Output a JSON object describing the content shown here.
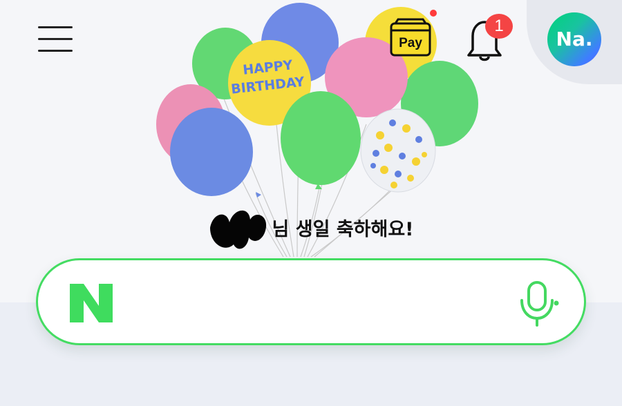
{
  "header": {
    "pay_label": "Pay",
    "notification_count": "1",
    "avatar_label": "Na."
  },
  "balloons": {
    "birthday_text_line1": "HAPPY",
    "birthday_text_line2": "BIRTHDAY"
  },
  "greeting": {
    "text": "님 생일 축하해요!"
  },
  "search": {
    "logo_letter": "N",
    "value": "",
    "placeholder": ""
  },
  "colors": {
    "accent_green": "#44dc62",
    "badge_red": "#f44444"
  },
  "icons": {
    "menu": "hamburger-icon",
    "pay": "pay-icon",
    "bell": "bell-icon",
    "mic": "microphone-icon"
  }
}
